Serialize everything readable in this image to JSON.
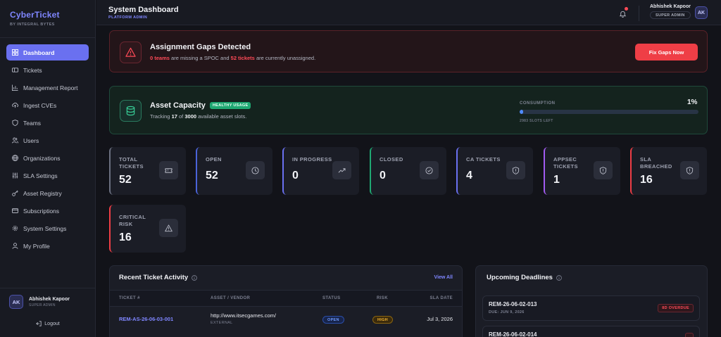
{
  "brand": {
    "title": "CyberTicket",
    "subtitle": "BY INTEGRAL BYTES"
  },
  "sidebar": {
    "items": [
      {
        "label": "Dashboard",
        "icon": "dashboard-icon",
        "active": true
      },
      {
        "label": "Tickets",
        "icon": "ticket-icon"
      },
      {
        "label": "Management Report",
        "icon": "bar-chart-icon"
      },
      {
        "label": "Ingest CVEs",
        "icon": "cloud-upload-icon"
      },
      {
        "label": "Teams",
        "icon": "shield-icon"
      },
      {
        "label": "Users",
        "icon": "users-icon"
      },
      {
        "label": "Organizations",
        "icon": "globe-icon"
      },
      {
        "label": "SLA Settings",
        "icon": "sliders-icon"
      },
      {
        "label": "Asset Registry",
        "icon": "key-icon"
      },
      {
        "label": "Subscriptions",
        "icon": "credit-card-icon"
      },
      {
        "label": "System Settings",
        "icon": "gear-icon"
      },
      {
        "label": "My Profile",
        "icon": "user-icon"
      }
    ],
    "user": {
      "initials": "AK",
      "name": "Abhishek Kapoor",
      "role": "SUPER ADMIN"
    },
    "logout": "Logout"
  },
  "header": {
    "title": "System Dashboard",
    "subtitle": "PLATFORM ADMIN",
    "user_name": "Abhishek Kapoor",
    "user_role": "SUPER ADMIN",
    "initials": "AK"
  },
  "alert": {
    "title": "Assignment Gaps Detected",
    "teams_count": "0 teams",
    "text_mid": " are missing a SPOC and ",
    "tickets_count": "52 tickets",
    "text_end": " are currently unassigned.",
    "button": "Fix Gaps Now"
  },
  "capacity": {
    "title": "Asset Capacity",
    "badge": "HEALTHY USAGE",
    "text_pre": "Tracking ",
    "tracked": "17",
    "text_mid": " of ",
    "total": "3000",
    "text_end": " available asset slots.",
    "consumption_label": "CONSUMPTION",
    "consumption_pct": "1%",
    "consumption_fraction": 0.01,
    "slots_left": "2983 SLOTS LEFT"
  },
  "stats": [
    {
      "label": "TOTAL TICKETS",
      "value": "52",
      "icon": "ticket-icon",
      "accent": "#6b7080"
    },
    {
      "label": "OPEN",
      "value": "52",
      "icon": "clock-icon",
      "accent": "#4a63d8"
    },
    {
      "label": "IN PROGRESS",
      "value": "0",
      "icon": "trending-up-icon",
      "accent": "#6a70f0"
    },
    {
      "label": "CLOSED",
      "value": "0",
      "icon": "check-circle-icon",
      "accent": "#1fa872"
    },
    {
      "label": "CA TICKETS",
      "value": "4",
      "icon": "shield-alert-icon",
      "accent": "#6a70f0"
    },
    {
      "label": "APPSEC TICKETS",
      "value": "1",
      "icon": "shield-alert-icon",
      "accent": "#a15bf0"
    },
    {
      "label": "SLA BREACHED",
      "value": "16",
      "icon": "shield-alert-icon",
      "accent": "#ef3e46"
    },
    {
      "label": "CRITICAL RISK",
      "value": "16",
      "icon": "warning-icon",
      "accent": "#ef3e46"
    }
  ],
  "activity": {
    "title": "Recent Ticket Activity",
    "view_all": "View All",
    "columns": [
      "TICKET #",
      "ASSET / VENDOR",
      "STATUS",
      "RISK",
      "SLA DATE"
    ],
    "rows": [
      {
        "ticket": "REM-AS-26-06-03-001",
        "asset": "http://www.itsecgames.com/",
        "vendor": "EXTERNAL",
        "status": "OPEN",
        "risk": "HIGH",
        "sla": "Jul 3, 2026"
      }
    ]
  },
  "deadlines": {
    "title": "Upcoming Deadlines",
    "items": [
      {
        "id": "REM-26-06-02-013",
        "due": "DUE: JUN 9, 2026",
        "badge": "8D OVERDUE"
      },
      {
        "id": "REM-26-06-02-014",
        "due": "",
        "badge": ""
      }
    ]
  }
}
